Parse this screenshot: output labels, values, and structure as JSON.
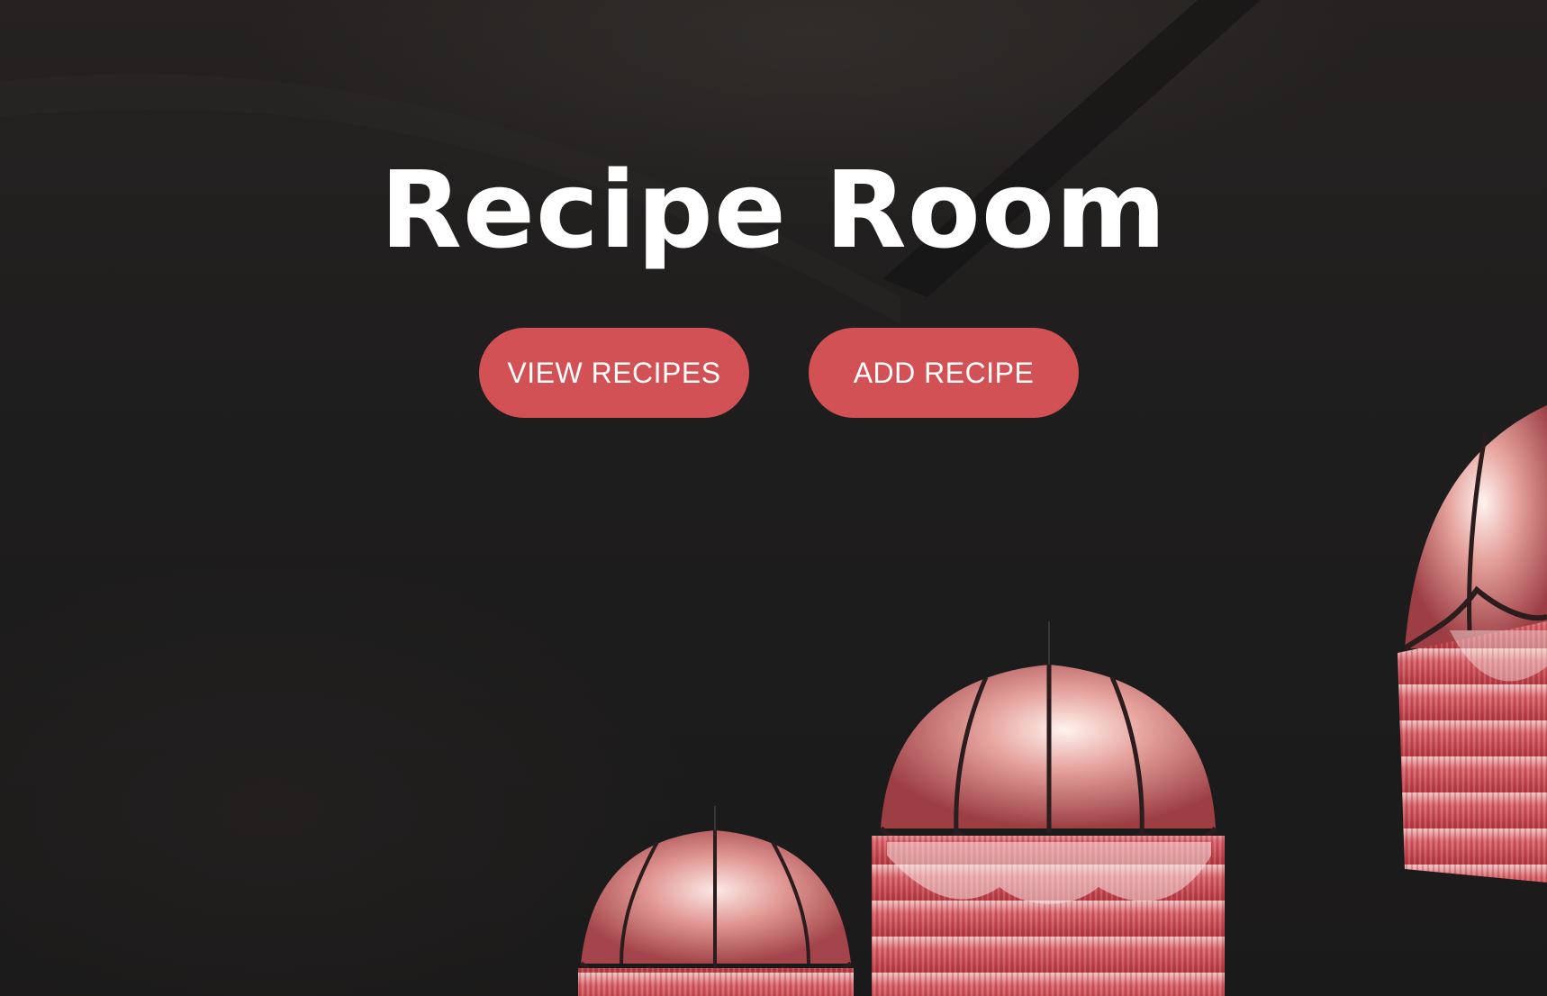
{
  "hero": {
    "title": "Recipe Room",
    "buttons": {
      "view_recipes": "VIEW RECIPES",
      "add_recipe": "ADD RECIPE"
    }
  },
  "colors": {
    "background": "#1c1b1b",
    "button": "#d15155",
    "button_text": "#ffffff",
    "title": "#ffffff",
    "lamp": "#c9444c"
  },
  "images": {
    "background": "pendant-lamps-photo"
  }
}
